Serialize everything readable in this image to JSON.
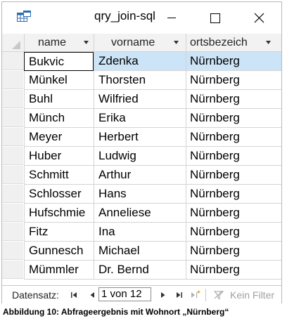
{
  "window": {
    "title": "qry_join-sql"
  },
  "icons": {
    "app": "query-table-icon",
    "minimize": "minimize-icon",
    "maximize": "maximize-icon",
    "close": "close-icon",
    "dropdown": "chevron-down-icon"
  },
  "grid": {
    "columns": [
      {
        "label": "name"
      },
      {
        "label": "vorname"
      },
      {
        "label": "ortsbezeich"
      }
    ],
    "rows": [
      {
        "name": "Bukvic",
        "vorname": "Zdenka",
        "ort": "Nürnberg"
      },
      {
        "name": "Münkel",
        "vorname": "Thorsten",
        "ort": "Nürnberg"
      },
      {
        "name": "Buhl",
        "vorname": "Wilfried",
        "ort": "Nürnberg"
      },
      {
        "name": "Münch",
        "vorname": "Erika",
        "ort": "Nürnberg"
      },
      {
        "name": "Meyer",
        "vorname": "Herbert",
        "ort": "Nürnberg"
      },
      {
        "name": "Huber",
        "vorname": "Ludwig",
        "ort": "Nürnberg"
      },
      {
        "name": "Schmitt",
        "vorname": "Arthur",
        "ort": "Nürnberg"
      },
      {
        "name": "Schlosser",
        "vorname": "Hans",
        "ort": "Nürnberg"
      },
      {
        "name": "Hufschmie",
        "vorname": "Anneliese",
        "ort": "Nürnberg"
      },
      {
        "name": "Fitz",
        "vorname": "Ina",
        "ort": "Nürnberg"
      },
      {
        "name": "Gunnesch",
        "vorname": "Michael",
        "ort": "Nürnberg"
      },
      {
        "name": "Mümmler",
        "vorname": "Dr. Bernd",
        "ort": "Nürnberg"
      }
    ]
  },
  "navigation": {
    "label": "Datensatz:",
    "position": "1 von 12",
    "filter_label": "Kein Filter"
  },
  "caption": "Abbildung 10: Abfrageergebnis mit Wohnort „Nürnberg“",
  "colors": {
    "selection_fill": "#cce4f7",
    "header_bg": "#f2f2f2",
    "app_icon": "#2b6cb0"
  }
}
